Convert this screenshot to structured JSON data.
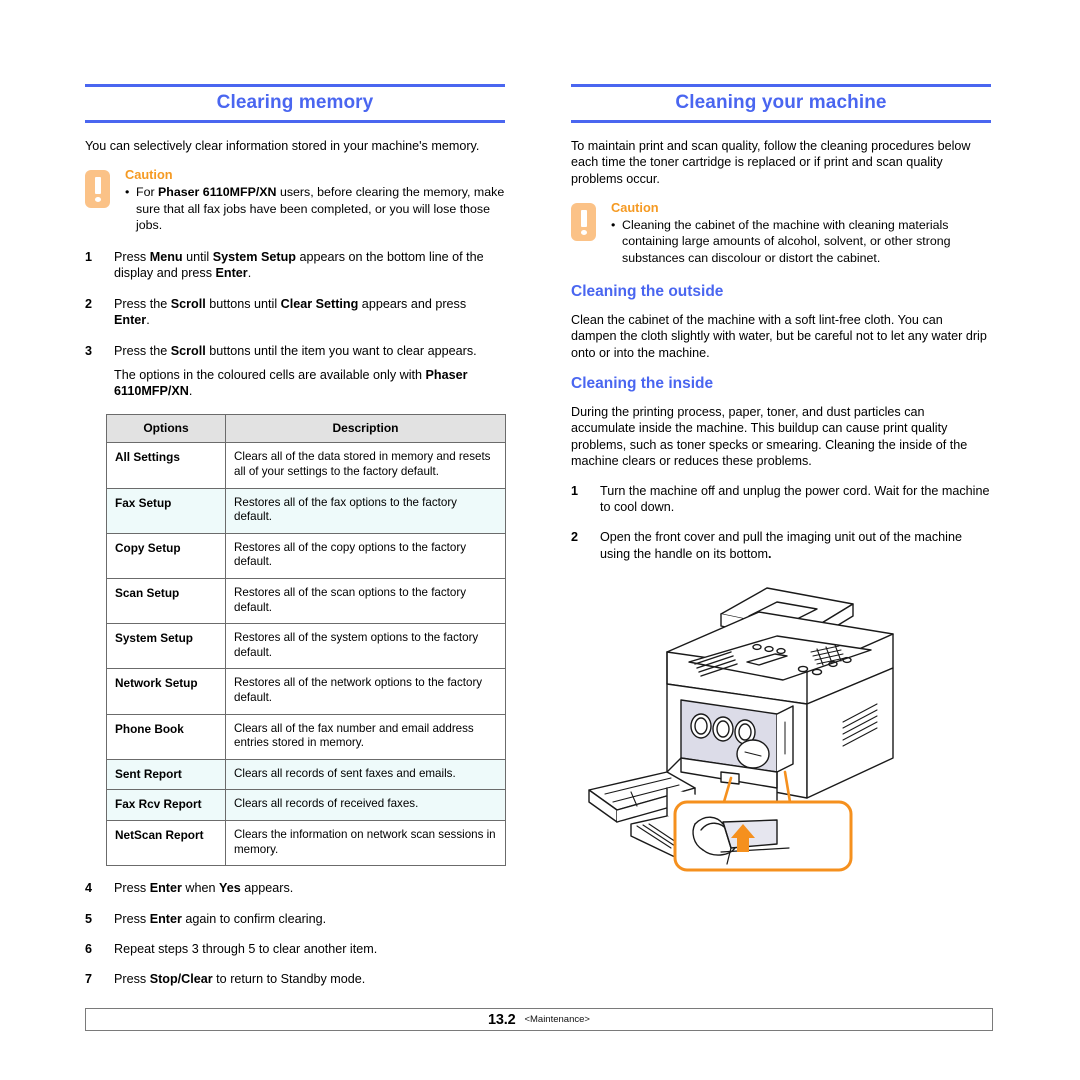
{
  "colors": {
    "heading_blue": "#4a66f0",
    "caution_orange": "#f59a23",
    "caution_icon_bg": "#fbc287",
    "table_header_bg": "#e2e2e2",
    "table_highlight_bg": "#eefafa"
  },
  "left_column": {
    "chapter_title": "Clearing memory",
    "intro": "You can selectively clear information stored in your machine's memory.",
    "caution": {
      "label": "Caution",
      "bullet_glyph": "•",
      "items": [
        {
          "prefix": "For ",
          "bold": "Phaser 6110MFP/XN",
          "suffix": " users, before clearing the memory, make sure that all fax jobs have been completed, or you will lose those jobs."
        }
      ]
    },
    "steps_before_table": [
      {
        "num": "1",
        "segments": [
          {
            "text": "Press ",
            "bold": false
          },
          {
            "text": "Menu",
            "bold": true
          },
          {
            "text": " until ",
            "bold": false
          },
          {
            "text": "System Setup",
            "bold": true
          },
          {
            "text": " appears on the bottom line of the display and press ",
            "bold": false
          },
          {
            "text": "Enter",
            "bold": true
          },
          {
            "text": ".",
            "bold": false
          }
        ]
      },
      {
        "num": "2",
        "segments": [
          {
            "text": "Press the ",
            "bold": false
          },
          {
            "text": "Scroll",
            "bold": true
          },
          {
            "text": " buttons until ",
            "bold": false
          },
          {
            "text": "Clear Setting",
            "bold": true
          },
          {
            "text": " appears and press ",
            "bold": false
          },
          {
            "text": "Enter",
            "bold": true
          },
          {
            "text": ".",
            "bold": false
          }
        ]
      },
      {
        "num": "3",
        "segments": [
          {
            "text": "Press the ",
            "bold": false
          },
          {
            "text": "Scroll",
            "bold": true
          },
          {
            "text": " buttons until the item you want to clear appears.",
            "bold": false
          }
        ]
      }
    ],
    "table_note": {
      "segments": [
        {
          "text": "The options in the coloured cells are available only with ",
          "bold": false
        },
        {
          "text": "Phaser 6110MFP/XN",
          "bold": true
        },
        {
          "text": ".",
          "bold": false
        }
      ]
    },
    "table": {
      "headers": [
        "Options",
        "Description"
      ],
      "rows": [
        {
          "option": "All Settings",
          "description": "Clears all of the data stored in memory and resets all of your settings to the factory default.",
          "highlight": false
        },
        {
          "option": "Fax Setup",
          "description": "Restores all of the fax options to the factory default.",
          "highlight": true
        },
        {
          "option": "Copy Setup",
          "description": "Restores all of the copy options to the factory default.",
          "highlight": false
        },
        {
          "option": "Scan Setup",
          "description": "Restores all of the scan options to the factory default.",
          "highlight": false
        },
        {
          "option": "System Setup",
          "description": "Restores all of the system options to the factory default.",
          "highlight": false
        },
        {
          "option": "Network Setup",
          "description": "Restores all of the network options to the factory default.",
          "highlight": false
        },
        {
          "option": "Phone Book",
          "description": "Clears all of the fax number and email address entries stored in memory.",
          "highlight": false
        },
        {
          "option": "Sent Report",
          "description": "Clears all records of sent faxes and emails.",
          "highlight": true
        },
        {
          "option": "Fax Rcv Report",
          "description": "Clears all records of received faxes.",
          "highlight": true
        },
        {
          "option": "NetScan Report",
          "description": "Clears the information on network scan sessions in memory.",
          "highlight": false
        }
      ]
    },
    "steps_after_table": [
      {
        "num": "4",
        "segments": [
          {
            "text": "Press ",
            "bold": false
          },
          {
            "text": "Enter",
            "bold": true
          },
          {
            "text": " when ",
            "bold": false
          },
          {
            "text": "Yes",
            "bold": true
          },
          {
            "text": " appears.",
            "bold": false
          }
        ]
      },
      {
        "num": "5",
        "segments": [
          {
            "text": "Press ",
            "bold": false
          },
          {
            "text": "Enter",
            "bold": true
          },
          {
            "text": " again to confirm clearing.",
            "bold": false
          }
        ]
      },
      {
        "num": "6",
        "segments": [
          {
            "text": "Repeat steps 3 through 5 to clear another item.",
            "bold": false
          }
        ]
      },
      {
        "num": "7",
        "segments": [
          {
            "text": "Press ",
            "bold": false
          },
          {
            "text": "Stop/Clear",
            "bold": true
          },
          {
            "text": " to return to Standby mode.",
            "bold": false
          }
        ]
      }
    ]
  },
  "right_column": {
    "chapter_title": "Cleaning your machine",
    "intro": "To maintain print and scan quality, follow the cleaning procedures below each time the toner cartridge is replaced or if print and scan quality problems occur.",
    "caution": {
      "label": "Caution",
      "bullet_glyph": "•",
      "items": [
        {
          "prefix": "",
          "bold": "",
          "suffix": "Cleaning the cabinet of the machine with cleaning materials containing large amounts of alcohol, solvent, or other strong substances can discolour or distort the cabinet."
        }
      ]
    },
    "section_outside": {
      "heading": "Cleaning the outside",
      "body": "Clean the cabinet of the machine with a soft lint-free cloth. You can dampen the cloth slightly with water, but be careful not to let any water drip onto or into the machine."
    },
    "section_inside": {
      "heading": "Cleaning the inside",
      "body": "During the printing process, paper, toner, and dust particles can accumulate inside the machine. This buildup can cause print quality problems, such as toner specks or smearing. Cleaning the inside of the machine clears or reduces these problems."
    },
    "steps": [
      {
        "num": "1",
        "segments": [
          {
            "text": "Turn the machine off and unplug the power cord. Wait for the machine to cool down.",
            "bold": false
          }
        ]
      },
      {
        "num": "2",
        "segments": [
          {
            "text": "Open the front cover and pull the imaging unit out of the machine using the handle on its bottom",
            "bold": false
          },
          {
            "text": ".",
            "bold": true
          }
        ]
      }
    ],
    "illustration": {
      "alt": "Line drawing of a multifunction printer with front cover open and a zoomed orange callout showing a hand pulling the imaging unit handle upward"
    }
  },
  "footer": {
    "page_number": "13.2",
    "section_name": "<Maintenance>"
  }
}
